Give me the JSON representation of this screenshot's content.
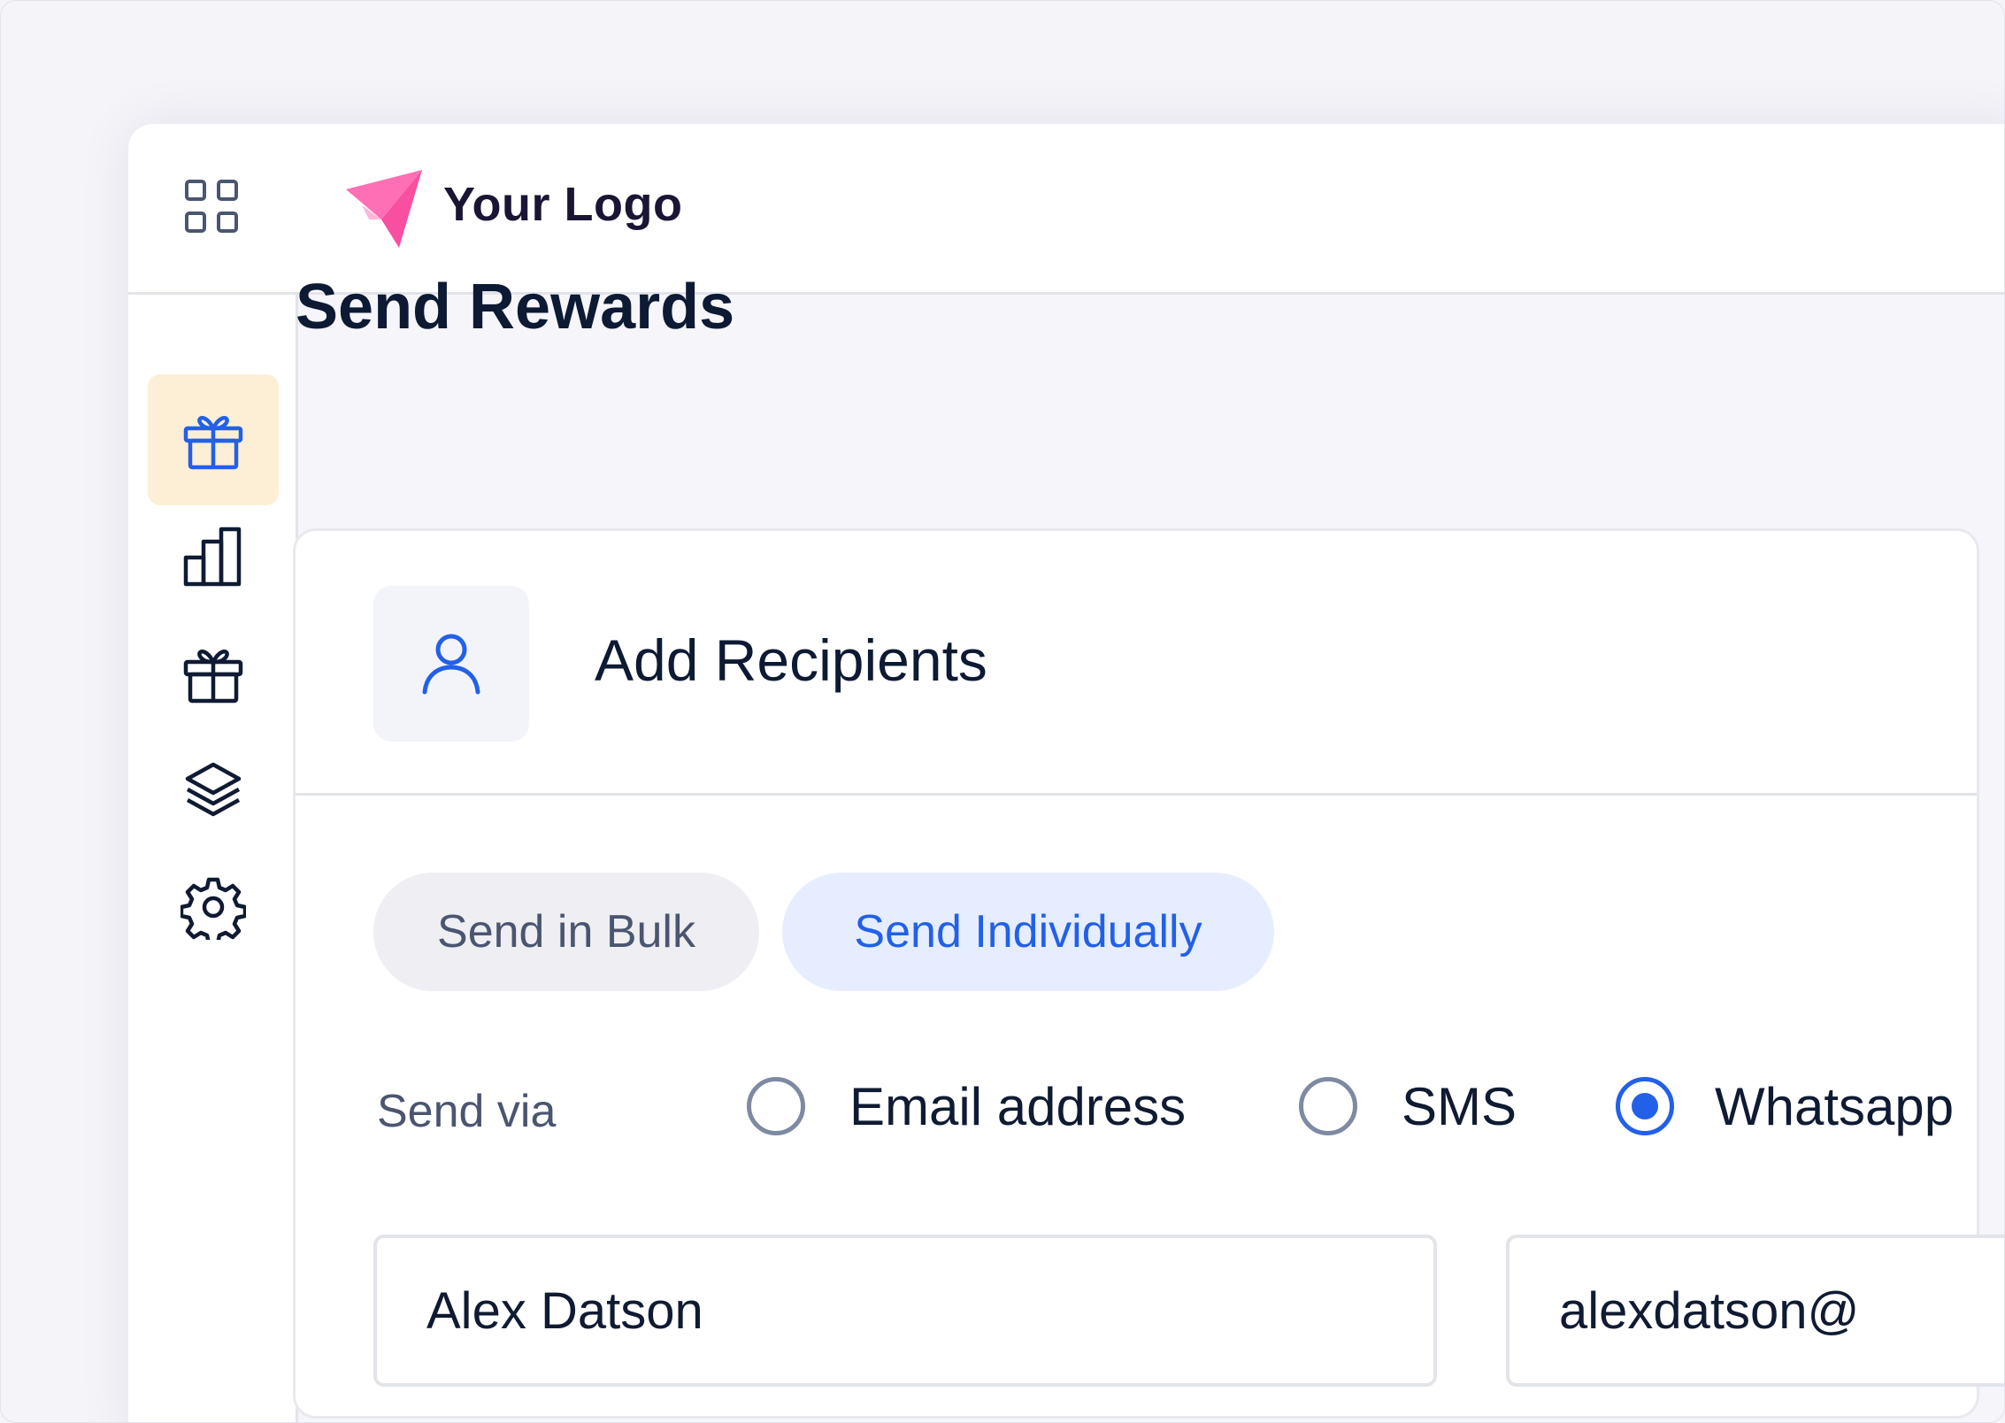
{
  "header": {
    "logo_text": "Your Logo"
  },
  "sidebar": {
    "items": [
      {
        "icon": "gift-icon",
        "active": true
      },
      {
        "icon": "bar-chart-icon",
        "active": false
      },
      {
        "icon": "gift-icon",
        "active": false
      },
      {
        "icon": "layers-icon",
        "active": false
      },
      {
        "icon": "gear-icon",
        "active": false
      }
    ]
  },
  "main": {
    "page_title": "Send Rewards",
    "card": {
      "title": "Add Recipients",
      "tabs": [
        {
          "label": "Send in Bulk",
          "selected": false
        },
        {
          "label": "Send Individually",
          "selected": true
        }
      ],
      "send_via": {
        "label": "Send via",
        "options": [
          {
            "label": "Email address",
            "checked": false
          },
          {
            "label": "SMS",
            "checked": false
          },
          {
            "label": "Whatsapp",
            "checked": true
          }
        ]
      },
      "fields": {
        "name_value": "Alex Datson",
        "email_value": "alexdatson@"
      }
    }
  },
  "colors": {
    "accent": "#2260e9",
    "active_bg": "#fdefd6",
    "logo_pink": "#ff6fb5",
    "text_dark": "#0f1b33"
  }
}
